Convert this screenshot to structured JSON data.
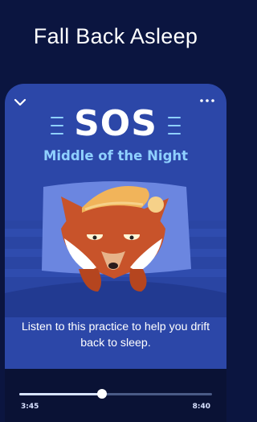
{
  "header": {
    "title": "Fall Back Asleep"
  },
  "player": {
    "title": "SOS",
    "subtitle": "Middle of the Night",
    "description": "Listen to this practice to help you drift back to sleep.",
    "collapse_icon": "chevron-down-icon",
    "menu_icon": "more-horizontal-icon",
    "elapsed": "3:45",
    "duration": "8:40",
    "progress_fraction": 0.43
  },
  "colors": {
    "background": "#0b1540",
    "card": "#2c47a8",
    "subtitle": "#8fd0ff",
    "fox": "#c8532a"
  }
}
